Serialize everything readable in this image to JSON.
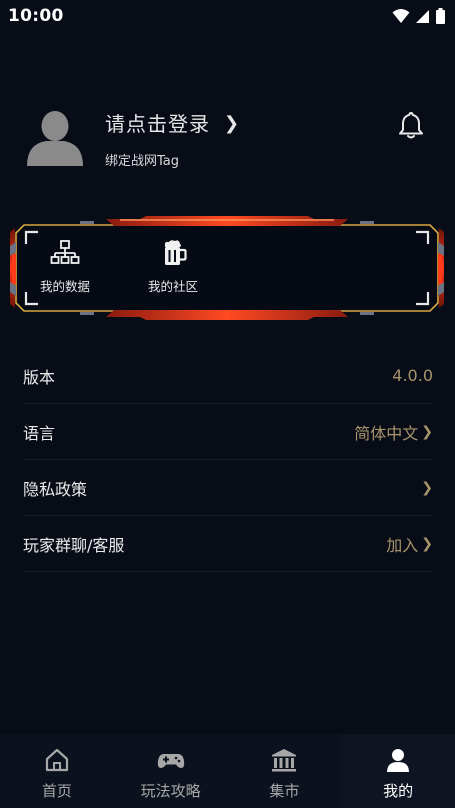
{
  "status_bar": {
    "time": "10:00",
    "icons": [
      "wifi-icon",
      "signal-icon",
      "battery-icon"
    ]
  },
  "profile": {
    "login_text": "请点击登录",
    "login_chevron": "❯",
    "bind_text": "绑定战网Tag",
    "avatar_icon": "avatar-placeholder-icon",
    "bell_icon": "bell-icon"
  },
  "quick_links": [
    {
      "label": "我的数据",
      "icon": "hierarchy-icon"
    },
    {
      "label": "我的社区",
      "icon": "beer-mug-icon"
    }
  ],
  "settings": [
    {
      "label": "版本",
      "value": "4.0.0",
      "chevron": ""
    },
    {
      "label": "语言",
      "value": "简体中文",
      "chevron": "❯"
    },
    {
      "label": "隐私政策",
      "value": "",
      "chevron": "❯"
    },
    {
      "label": "玩家群聊/客服",
      "value": "加入",
      "chevron": "❯"
    }
  ],
  "tabs": [
    {
      "label": "首页",
      "icon": "home-icon",
      "active": false
    },
    {
      "label": "玩法攻略",
      "icon": "gamepad-icon",
      "active": false
    },
    {
      "label": "集市",
      "icon": "market-icon",
      "active": false
    },
    {
      "label": "我的",
      "icon": "person-icon",
      "active": true
    }
  ],
  "colors": {
    "background": "#070c17",
    "accent_gold": "#a8946c",
    "frame_red": "#e8321a",
    "frame_gold": "#d9a742",
    "tab_bar": "#0b111d"
  }
}
